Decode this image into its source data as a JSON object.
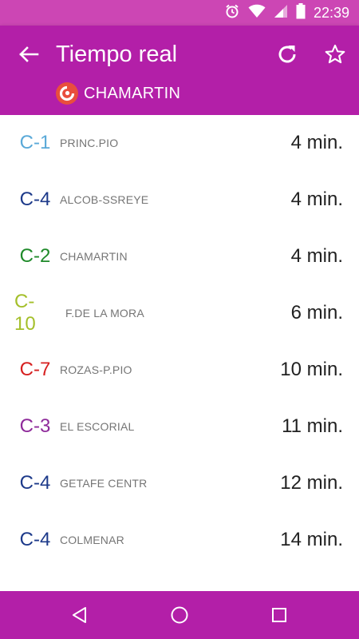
{
  "status_bar": {
    "time": "22:39",
    "icons": [
      "alarm-icon",
      "wifi-icon",
      "signal-icon",
      "battery-icon"
    ]
  },
  "app_bar": {
    "title": "Tiempo real",
    "station": "CHAMARTIN",
    "icons": [
      "back-arrow-icon",
      "refresh-icon",
      "star-outline-icon",
      "station-logo-icon"
    ]
  },
  "departures": [
    {
      "line": "C-1",
      "destination": "PRINC.PIO",
      "time": "4 min.",
      "color": "#5aa9d8"
    },
    {
      "line": "C-4",
      "destination": "ALCOB-SSREYE",
      "time": "4 min.",
      "color": "#1d3a8a"
    },
    {
      "line": "C-2",
      "destination": "CHAMARTIN",
      "time": "4 min.",
      "color": "#1f8a2a"
    },
    {
      "line": "C-10",
      "destination": "F.DE LA MORA",
      "time": "6 min.",
      "color": "#a4bf2a"
    },
    {
      "line": "C-7",
      "destination": "ROZAS-P.PIO",
      "time": "10 min.",
      "color": "#d62020"
    },
    {
      "line": "C-3",
      "destination": "EL ESCORIAL",
      "time": "11 min.",
      "color": "#8e2a9a"
    },
    {
      "line": "C-4",
      "destination": "GETAFE CENTR",
      "time": "12 min.",
      "color": "#1d3a8a"
    },
    {
      "line": "C-4",
      "destination": "COLMENAR",
      "time": "14 min.",
      "color": "#1d3a8a"
    }
  ],
  "nav_bar": {
    "icons": [
      "back-triangle-icon",
      "home-circle-icon",
      "recents-square-icon"
    ]
  },
  "colors": {
    "status_bar": "#cc46b4",
    "app_bar": "#b31fa8",
    "nav_bar": "#b31fa8",
    "station_logo": "#e94e3d"
  }
}
